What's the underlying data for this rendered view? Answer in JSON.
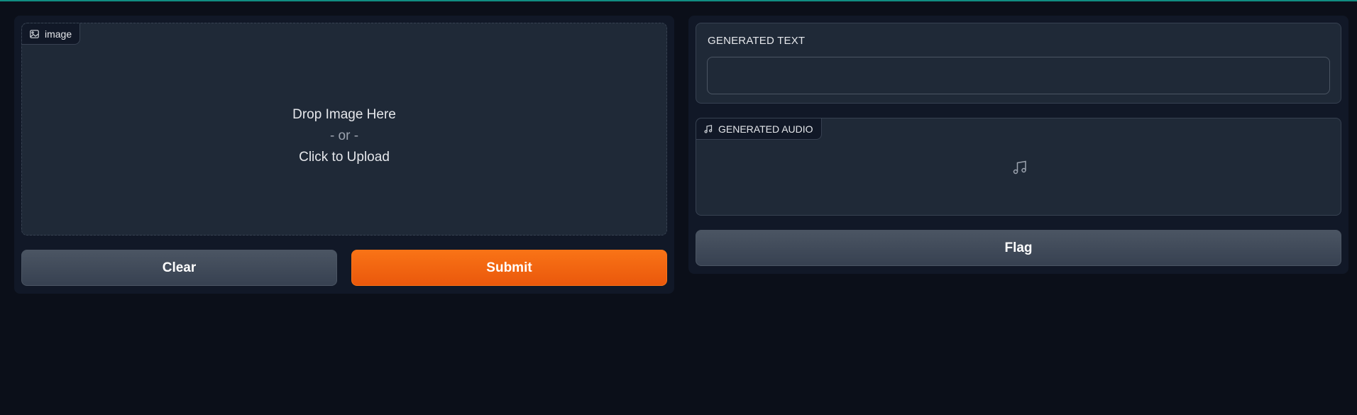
{
  "image_input": {
    "label": "image",
    "drop_title": "Drop Image Here",
    "drop_or": "- or -",
    "drop_action": "Click to Upload"
  },
  "buttons": {
    "clear": "Clear",
    "submit": "Submit",
    "flag": "Flag"
  },
  "outputs": {
    "text_label": "GENERATED TEXT",
    "text_value": "",
    "audio_label": "GENERATED AUDIO"
  },
  "colors": {
    "background": "#0b0f19",
    "panel": "#111827",
    "block": "#1f2937",
    "primary": "#f97316",
    "secondary": "#4b5563",
    "accent": "#14b8a6"
  },
  "icons": {
    "image_label_icon": "image-icon",
    "audio_label_icon": "music-note-icon",
    "audio_placeholder_icon": "music-note-icon"
  }
}
